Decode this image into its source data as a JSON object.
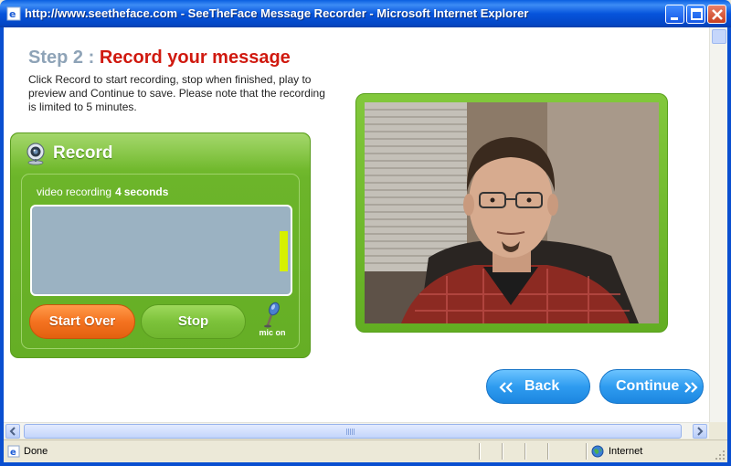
{
  "window": {
    "title": "http://www.seetheface.com - SeeTheFace Message Recorder - Microsoft Internet Explorer",
    "buttons": [
      "minimize",
      "maximize",
      "close"
    ]
  },
  "page": {
    "step_label": "Step 2 :",
    "step_title": "Record your message",
    "instructions": "Click Record to start recording, stop when finished, play to preview and Continue to save. Please note that the recording is limited to 5 minutes."
  },
  "recorder": {
    "title": "Record",
    "icon": "webcam-icon",
    "status_label": "video recording",
    "duration_value": "4",
    "duration_unit": "seconds",
    "audio_level": 0.45,
    "start_over_label": "Start Over",
    "stop_label": "Stop",
    "mic_label": "mic on",
    "mic_icon": "microphone-icon"
  },
  "video": {
    "description_icon": "webcam-feed"
  },
  "nav": {
    "back_label": "Back",
    "continue_label": "Continue"
  },
  "statusbar": {
    "status": "Done",
    "zone": "Internet"
  },
  "colors": {
    "titlebar": "#0654dc",
    "step_label": "#8ea3b7",
    "step_title": "#d0190f",
    "panel_green": "#6cb52a",
    "start_over_orange": "#f47320",
    "nav_blue": "#2f9cf0",
    "screen": "#9bb2c2",
    "level": "#d6f000"
  }
}
